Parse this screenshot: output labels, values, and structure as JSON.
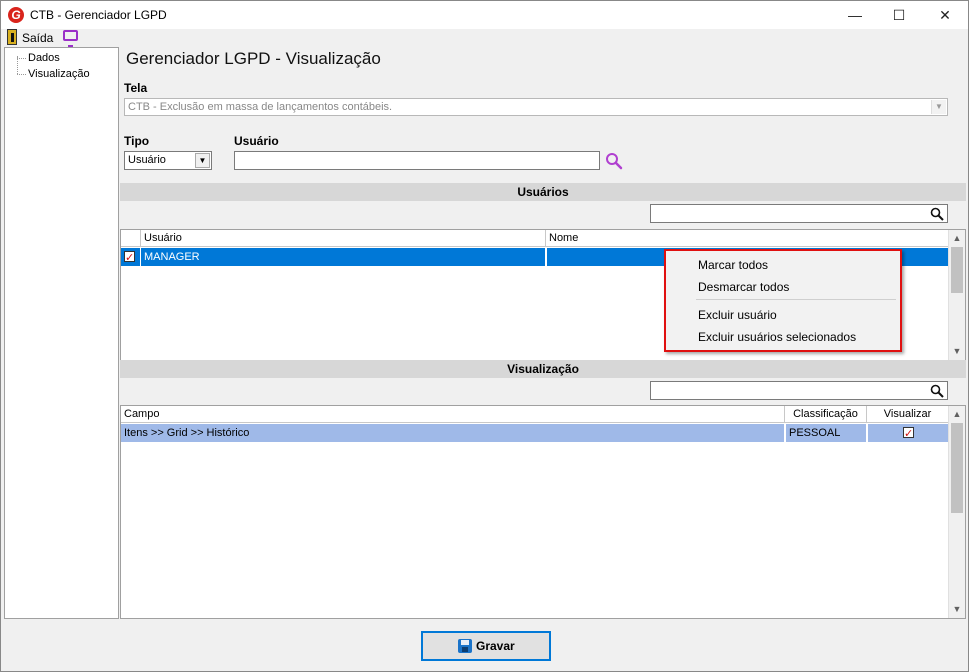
{
  "window": {
    "title": "CTB - Gerenciador LGPD",
    "logo_letter": "G",
    "minimize_glyph": "—",
    "maximize_glyph": "☐",
    "close_glyph": "✕"
  },
  "toolbar": {
    "exit_label": "Saída",
    "exit_icon": "door-exit-icon",
    "monitor_icon": "monitor-icon"
  },
  "tree": {
    "items": [
      {
        "label": "Dados"
      },
      {
        "label": "Visualização"
      }
    ]
  },
  "main": {
    "page_title": "Gerenciador LGPD - Visualização",
    "tela_label": "Tela",
    "tela_value": "CTB - Exclusão em massa de lançamentos contábeis.",
    "tipo_label": "Tipo",
    "tipo_value": "Usuário",
    "usuario_label": "Usuário",
    "usuario_value": ""
  },
  "users_section": {
    "header": "Usuários",
    "search_value": "",
    "columns": [
      "Usuário",
      "Nome"
    ],
    "rows": [
      {
        "checked": true,
        "usuario": "MANAGER",
        "nome": ""
      }
    ]
  },
  "context_menu": {
    "items": [
      "Marcar todos",
      "Desmarcar todos",
      "Excluir usuário",
      "Excluir usuários selecionados"
    ]
  },
  "view_section": {
    "header": "Visualização",
    "search_value": "",
    "columns": [
      "Campo",
      "Classificação",
      "Visualizar"
    ],
    "rows": [
      {
        "campo": "Itens >> Grid >> Histórico",
        "classificacao": "PESSOAL",
        "visualizar": true
      }
    ]
  },
  "footer": {
    "save_label": "Gravar"
  },
  "colors": {
    "selection_blue": "#0078d7",
    "selection_lightblue": "#9fb9e8",
    "highlight_red": "#e01010",
    "section_gray": "#d7d7d7"
  }
}
